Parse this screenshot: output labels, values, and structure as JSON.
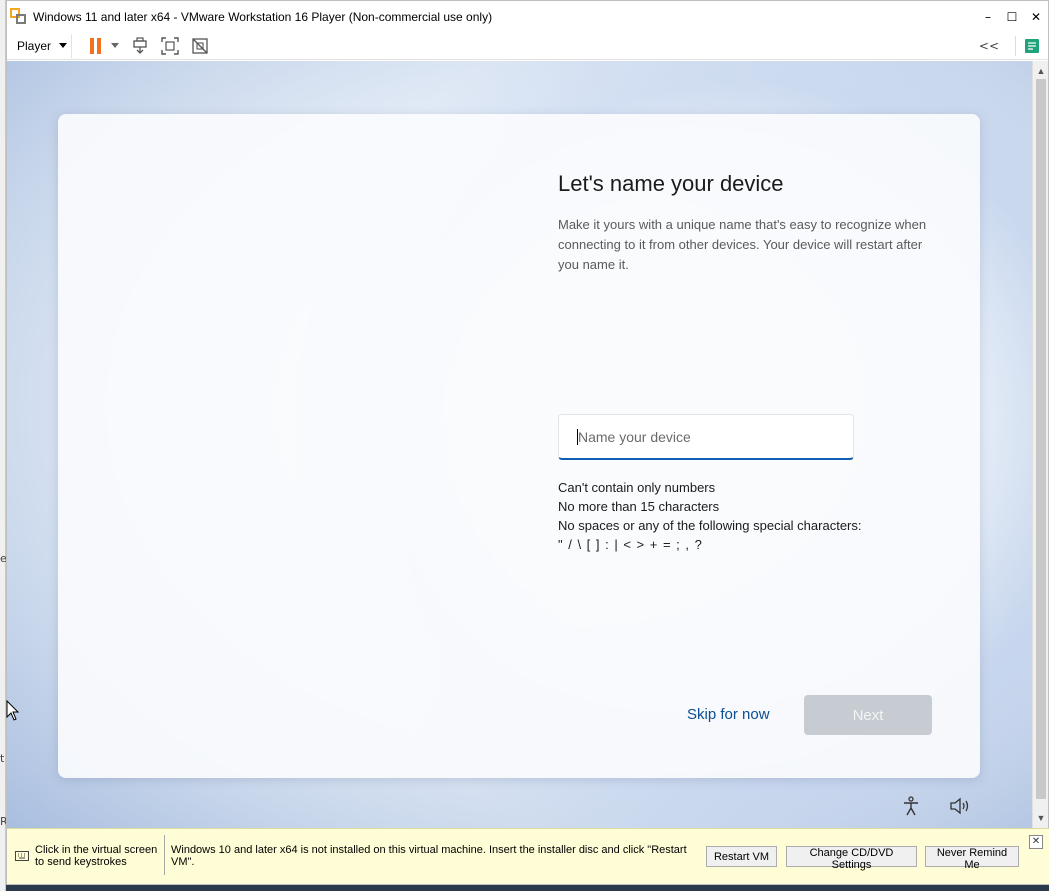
{
  "window": {
    "title": "Windows 11 and later x64 - VMware Workstation 16 Player (Non-commercial use only)",
    "controls": {
      "minimize": "–",
      "maximize": "☐",
      "close": "✕"
    }
  },
  "toolbar": {
    "player_menu_label": "Player",
    "icons": [
      "pause-icon",
      "send-ctrl-alt-del-icon",
      "full-screen-icon",
      "unity-icon"
    ],
    "collapse_label": "<<",
    "accent": "#f2711c"
  },
  "oobe": {
    "heading": "Let's name your device",
    "description": "Make it yours with a unique name that's easy to recognize when connecting to it from other devices. Your device will restart after you name it.",
    "input_placeholder": "Name your device",
    "input_value": "",
    "rules": [
      "Can't contain only numbers",
      "No more than 15 characters",
      "No spaces or any of the following special characters:",
      "\" / \\ [ ] : | < > + = ; , ?"
    ],
    "skip_label": "Skip for now",
    "next_label": "Next",
    "accent": "#0f5fb5",
    "link_color": "#0b4d8f"
  },
  "notification": {
    "hint": "Click in the virtual screen to send keystrokes",
    "message": "Windows 10 and later x64 is not installed on this virtual machine. Insert the installer disc and click \"Restart VM\".",
    "buttons": {
      "restart": "Restart VM",
      "cd": "Change CD/DVD Settings",
      "never": "Never Remind Me"
    },
    "close": "✕",
    "background": "#fffdd6"
  },
  "desktop_edge_marks": [
    "ec",
    "t",
    "R"
  ]
}
